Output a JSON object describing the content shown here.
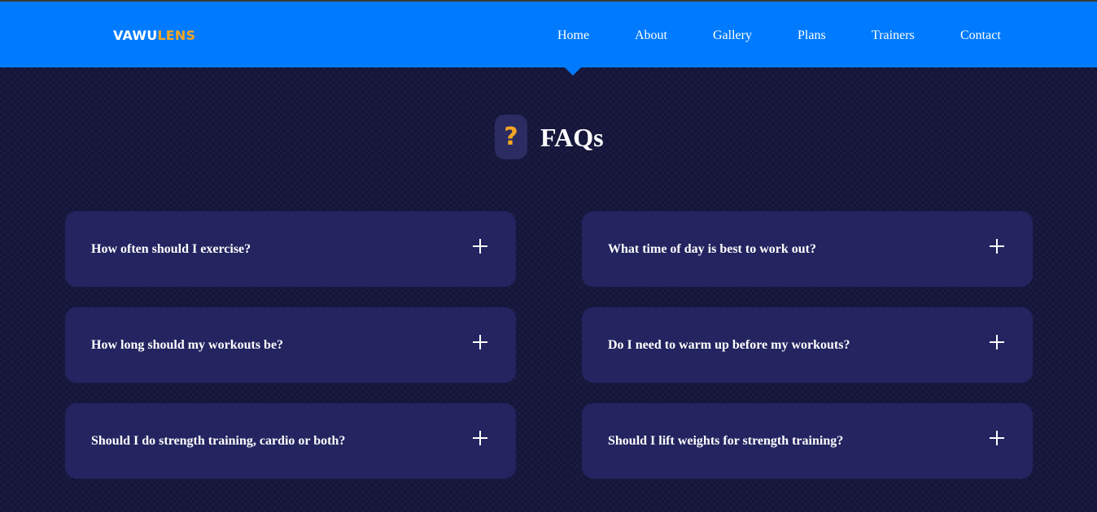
{
  "brand": {
    "logo_primary": "VAWU",
    "logo_accent": "LENS",
    "primary_color": "#007bff",
    "accent_color": "#f5a623",
    "background_color": "#14153a",
    "card_color": "#232460"
  },
  "nav": {
    "active": "Home",
    "items": [
      {
        "label": "Home"
      },
      {
        "label": "About"
      },
      {
        "label": "Gallery"
      },
      {
        "label": "Plans"
      },
      {
        "label": "Trainers"
      },
      {
        "label": "Contact"
      }
    ]
  },
  "faq": {
    "icon_glyph": "?",
    "icon": "question-mark-icon",
    "title": "FAQs",
    "items": [
      {
        "question": "How often should I exercise?",
        "icon": "plus-icon"
      },
      {
        "question": "What time of day is best to work out?",
        "icon": "plus-icon"
      },
      {
        "question": "How long should my workouts be?",
        "icon": "plus-icon"
      },
      {
        "question": "Do I need to warm up before my workouts?",
        "icon": "plus-icon"
      },
      {
        "question": "Should I do strength training, cardio or both?",
        "icon": "plus-icon"
      },
      {
        "question": "Should I lift weights for strength training?",
        "icon": "plus-icon"
      }
    ]
  }
}
